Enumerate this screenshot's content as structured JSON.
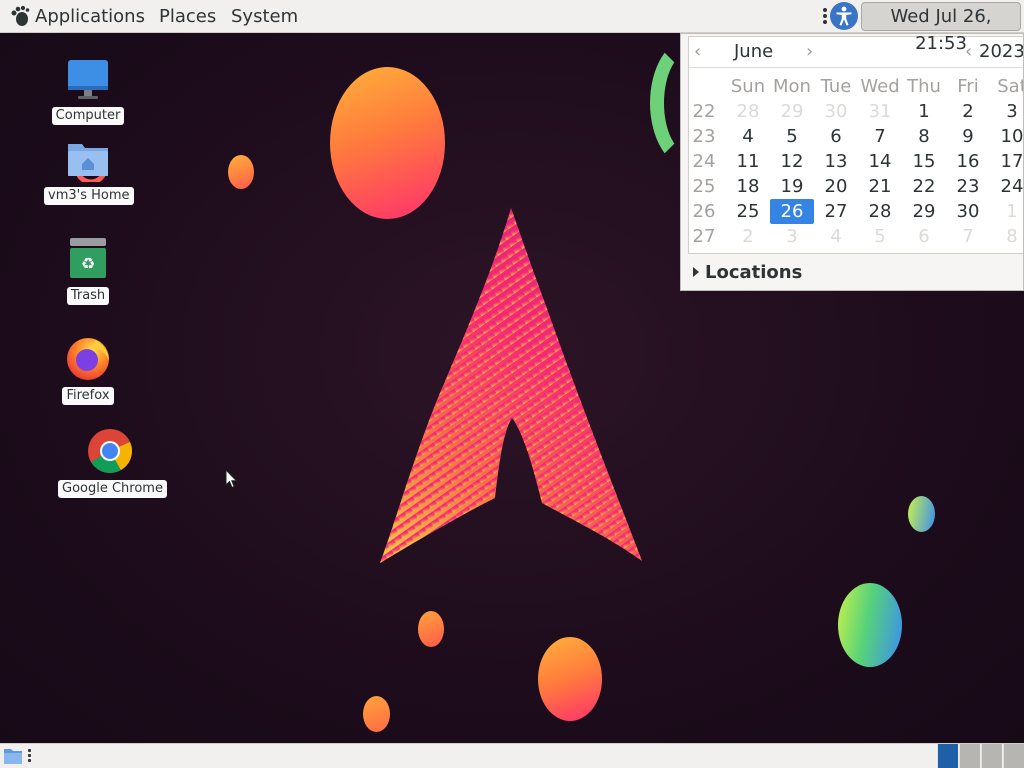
{
  "top_panel": {
    "applications_label": "Applications",
    "places_label": "Places",
    "system_label": "System",
    "clock": "Wed Jul 26, 21:53"
  },
  "desktop": {
    "icons": [
      {
        "label": "Computer"
      },
      {
        "label": "vm3's Home"
      },
      {
        "label": "Trash"
      },
      {
        "label": "Firefox"
      },
      {
        "label": "Google Chrome"
      }
    ]
  },
  "calendar": {
    "month": "June",
    "year": "2023",
    "prev_glyph": "‹",
    "next_glyph": "›",
    "weekdays": [
      "Sun",
      "Mon",
      "Tue",
      "Wed",
      "Thu",
      "Fri",
      "Sat"
    ],
    "weeks": [
      {
        "num": "22",
        "days": [
          "28",
          "29",
          "30",
          "31",
          "1",
          "2",
          "3"
        ]
      },
      {
        "num": "23",
        "days": [
          "4",
          "5",
          "6",
          "7",
          "8",
          "9",
          "10"
        ]
      },
      {
        "num": "24",
        "days": [
          "11",
          "12",
          "13",
          "14",
          "15",
          "16",
          "17"
        ]
      },
      {
        "num": "25",
        "days": [
          "18",
          "19",
          "20",
          "21",
          "22",
          "23",
          "24"
        ]
      },
      {
        "num": "26",
        "days": [
          "25",
          "26",
          "27",
          "28",
          "29",
          "30",
          "1"
        ]
      },
      {
        "num": "27",
        "days": [
          "2",
          "3",
          "4",
          "5",
          "6",
          "7",
          "8"
        ]
      }
    ],
    "other_month": [
      [
        0,
        1,
        2,
        3
      ],
      [],
      [],
      [],
      [
        6
      ],
      [
        0,
        1,
        2,
        3,
        4,
        5,
        6
      ]
    ],
    "selected_day": "26",
    "locations_label": "Locations"
  },
  "colors": {
    "panel_bg": "#f1f0ee",
    "desktop_bg": "#1e0d1e",
    "accent": "#3584e4",
    "arch_logo": "#e8307a"
  },
  "bottom_panel": {
    "workspaces_count_visible": 4,
    "active_workspace": 1
  }
}
